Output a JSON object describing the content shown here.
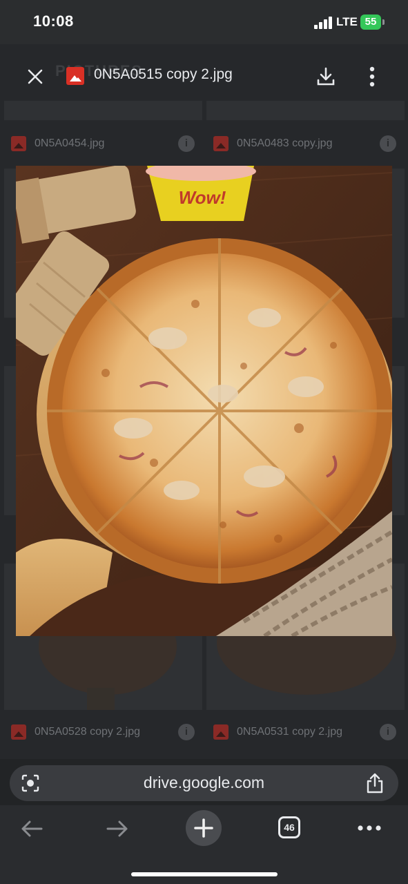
{
  "status_bar": {
    "time": "10:08",
    "network": "LTE",
    "battery": "55"
  },
  "background": {
    "folder_title": "PICTURES",
    "files": [
      {
        "name": "0N5A0454.jpg"
      },
      {
        "name": "0N5A0483 copy.jpg"
      },
      {
        "name": "0N5A0528 copy 2.jpg"
      },
      {
        "name": "0N5A0531 copy 2.jpg"
      }
    ]
  },
  "viewer": {
    "file_name": "0N5A0515 copy 2.jpg",
    "icons": {
      "close": "close-icon",
      "file_type": "image-file-icon",
      "download": "download-icon",
      "more": "more-vert-icon"
    },
    "image_alt": "Pizza on wooden board with pepper mills and drink cup",
    "cup_brand": "Wow!"
  },
  "browser": {
    "url": "drive.google.com",
    "tab_count": "46",
    "icons": {
      "lens": "lens-icon",
      "share": "share-icon",
      "back": "back-arrow-icon",
      "forward": "forward-arrow-icon",
      "new_tab": "plus-icon",
      "tabs": "tabs-icon",
      "menu": "more-horiz-icon"
    }
  },
  "colors": {
    "accent_red": "#d93025",
    "battery_green": "#34c759",
    "background": "#222426"
  }
}
